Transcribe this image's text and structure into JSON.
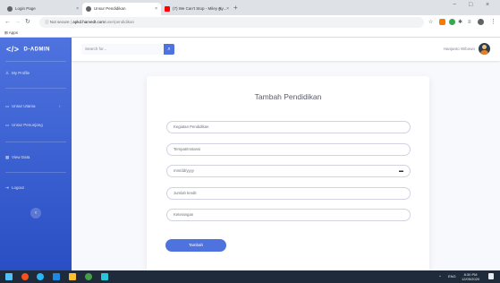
{
  "browser": {
    "tabs": [
      {
        "title": "Login Page",
        "favicon_color": "#3c4043"
      },
      {
        "title": "Unsur Pendidikan",
        "favicon_color": "#3c4043"
      },
      {
        "title": "(7) We Can't Stop - Miley Cy...",
        "favicon_color": "#ff0000"
      }
    ],
    "tab_close": "×",
    "audio_icon": "🔊",
    "new_tab": "+",
    "window_controls": [
      "−",
      "□",
      "×"
    ],
    "address": {
      "security_label": "Not secure",
      "host": "apkd.harvedt.com",
      "path": "/user/pendidikan"
    },
    "bookmarks_label": "Apps"
  },
  "sidebar": {
    "brand": "D-ADMIN",
    "items": [
      {
        "label": "My Profile",
        "icon": "user-icon"
      },
      {
        "label": "Unsur Utama",
        "icon": "folder-icon",
        "chevron": "›"
      },
      {
        "label": "Unsur Penunjang",
        "icon": "folder-icon"
      },
      {
        "label": "View Data",
        "icon": "table-icon"
      },
      {
        "label": "Logout",
        "icon": "logout-icon"
      }
    ],
    "toggle": "‹"
  },
  "topbar": {
    "search_placeholder": "Search for...",
    "username": "Hanjanto Wibowo"
  },
  "form": {
    "title": "Tambah Pendidikan",
    "fields": [
      {
        "placeholder": "Kegiatan Pendidikan"
      },
      {
        "placeholder": "Tempat/Instansi"
      },
      {
        "placeholder": "mm/dd/yyyy"
      },
      {
        "placeholder": "Jumlah kredit"
      },
      {
        "placeholder": "Keterangan"
      }
    ],
    "submit_label": "Tambah"
  },
  "taskbar": {
    "lang": "ENG",
    "time": "8:30 PM",
    "date": "12/05/2020",
    "tray_arrow": "^"
  },
  "colors": {
    "primary": "#4e73df",
    "sidebar_gradient_end": "#2a4fc4"
  }
}
